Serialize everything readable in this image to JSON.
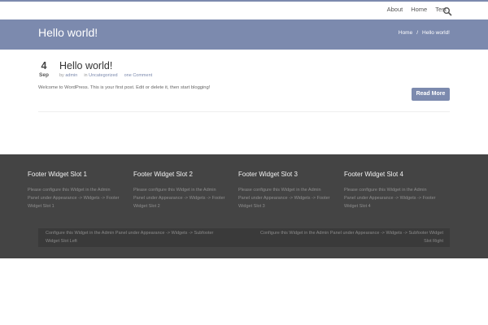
{
  "nav": {
    "items": [
      "About",
      "Home",
      "Test"
    ],
    "search_icon": "search-icon"
  },
  "title_bar": {
    "title": "Hello world!",
    "breadcrumb": {
      "home": "Home",
      "separator": "/",
      "current": "Hello world!"
    }
  },
  "post": {
    "day": "4",
    "month": "Sep",
    "title": "Hello world!",
    "meta": {
      "by": "by",
      "author": "admin",
      "in": "in",
      "category": "Uncategorized",
      "comments": "one Comment"
    },
    "excerpt": "Welcome to WordPress. This is your first post. Edit or delete it, then start blogging!",
    "read_more": "Read More"
  },
  "footer": {
    "widgets": [
      {
        "title": "Footer Widget Slot 1",
        "text": "Please configure this Widget in the Admin Panel under Appearance -> Widgets -> Footer Widget Slot 1"
      },
      {
        "title": "Footer Widget Slot 2",
        "text": "Please configure this Widget in the Admin Panel under Appearance -> Widgets -> Footer Widget Slot 2"
      },
      {
        "title": "Footer Widget Slot 3",
        "text": "Please configure this Widget in the Admin Panel under Appearance -> Widgets -> Footer Widget Slot 3"
      },
      {
        "title": "Footer Widget Slot 4",
        "text": "Please configure this Widget in the Admin Panel under Appearance -> Widgets -> Footer Widget Slot 4"
      }
    ],
    "subfooter_left": "Configure this Widget in the Admin Panel under Appearance -> Widgets -> Subfooter Widget Slot Left",
    "subfooter_right": "Configure this Widget in the Admin Panel under Appearance -> Widgets -> Subfooter Widget Slot Right"
  },
  "colors": {
    "accent": "#7c8aae",
    "footer_bg": "#444444",
    "subfooter_bg": "#3a3a3a"
  }
}
